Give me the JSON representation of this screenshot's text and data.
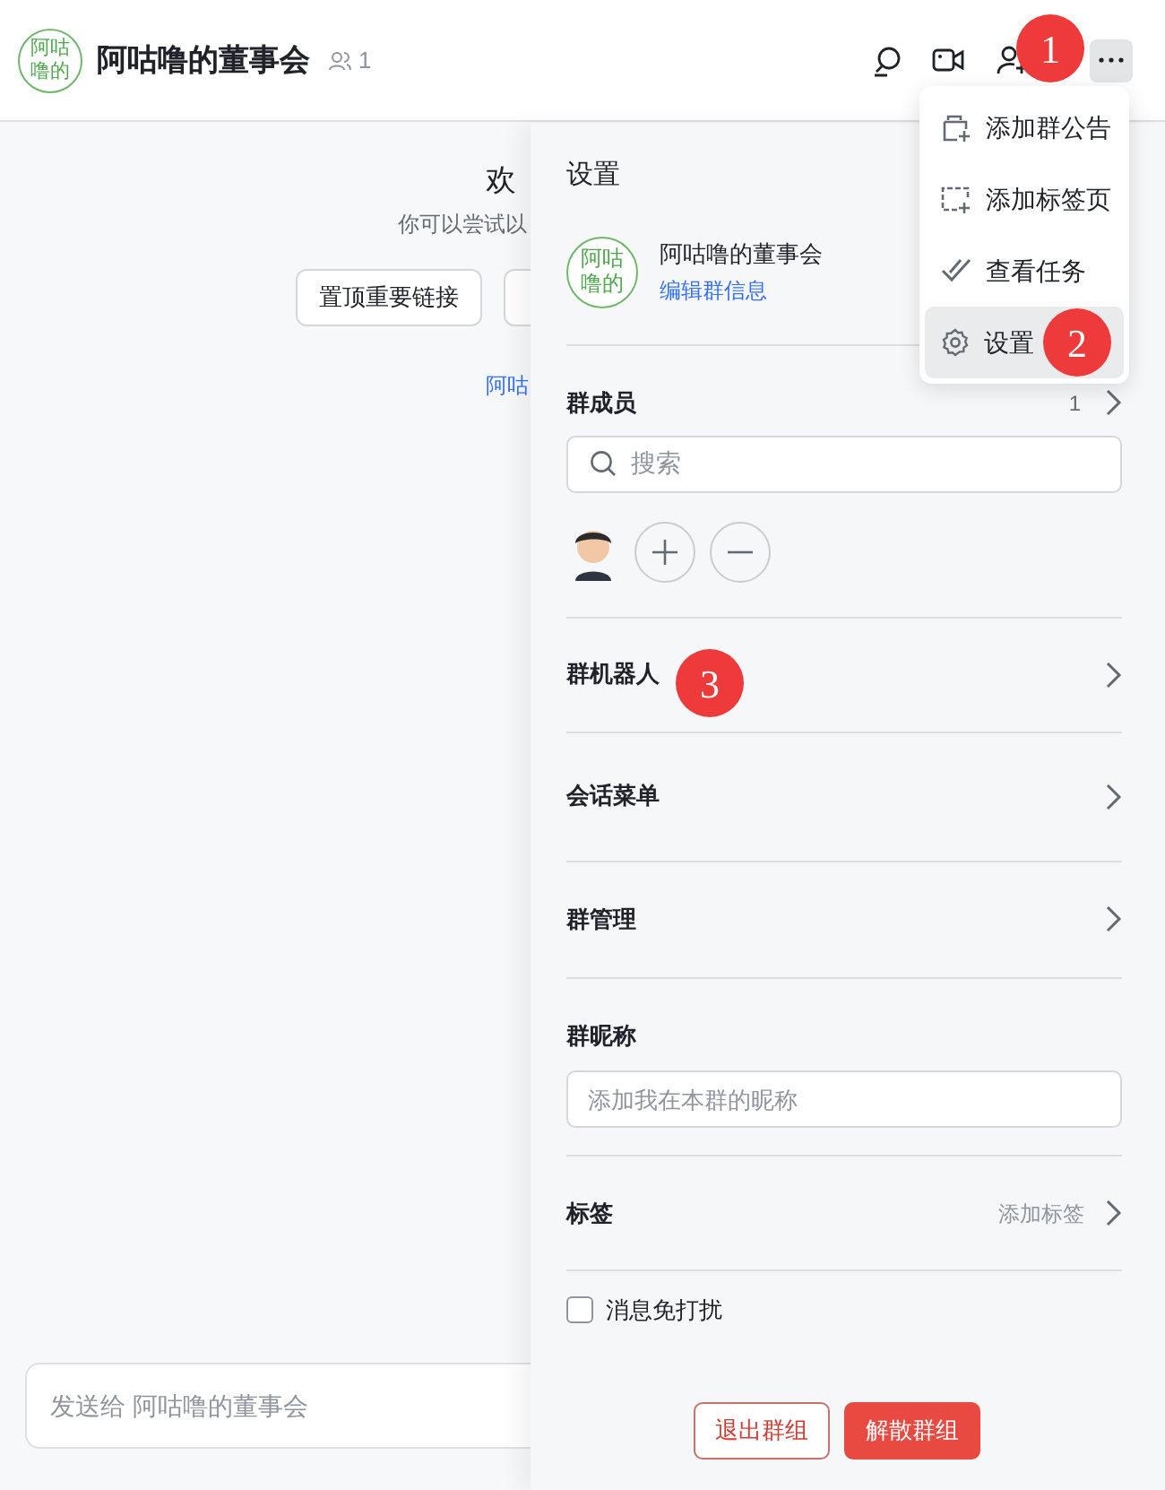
{
  "header": {
    "avatar_text": "阿咕噜的",
    "title": "阿咕噜的董事会",
    "member_count": "1"
  },
  "chat": {
    "welcome_title": "欢",
    "welcome_subtitle": "你可以尝试以",
    "quick_actions": [
      "置顶重要链接"
    ],
    "link": "阿咕",
    "input_placeholder": "发送给 阿咕噜的董事会"
  },
  "more_menu": [
    {
      "kind": "announcement",
      "label": "添加群公告",
      "selected": false
    },
    {
      "kind": "tab",
      "label": "添加标签页",
      "selected": false
    },
    {
      "kind": "task",
      "label": "查看任务",
      "selected": false
    },
    {
      "kind": "settings",
      "label": "设置",
      "selected": true
    }
  ],
  "settings": {
    "title": "设置",
    "group_avatar_text": "阿咕噜的",
    "group_name": "阿咕噜的董事会",
    "edit_link": "编辑群信息",
    "members": {
      "label": "群成员",
      "count": "1",
      "search_placeholder": "搜索"
    },
    "rows": [
      {
        "label": "群机器人"
      },
      {
        "label": "会话菜单"
      },
      {
        "label": "群管理"
      }
    ],
    "nickname": {
      "label": "群昵称",
      "placeholder": "添加我在本群的昵称"
    },
    "tags": {
      "label": "标签",
      "action": "添加标签"
    },
    "mute": {
      "label": "消息免打扰",
      "checked": false
    },
    "buttons": [
      {
        "kind": "outline",
        "label": "退出群组"
      },
      {
        "kind": "danger",
        "label": "解散群组"
      }
    ]
  },
  "markers": [
    {
      "label": "1"
    },
    {
      "label": "2"
    },
    {
      "label": "3"
    }
  ]
}
